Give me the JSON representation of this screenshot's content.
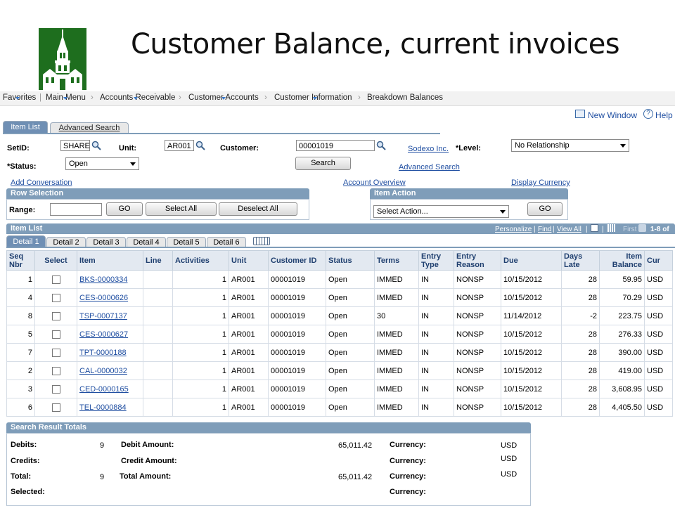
{
  "slide": {
    "title": "Customer Balance, current invoices"
  },
  "breadcrumb": [
    {
      "label": "Favorites",
      "has_arrow": true
    },
    {
      "label": "Main Menu",
      "has_arrow": true
    },
    {
      "label": "Accounts Receivable",
      "has_arrow": true
    },
    {
      "label": "Customer Accounts",
      "has_arrow": true
    },
    {
      "label": "Customer Information",
      "has_arrow": true
    },
    {
      "label": "Breakdown Balances",
      "has_arrow": false
    }
  ],
  "toplinks": {
    "new_window": "New Window",
    "help": "Help"
  },
  "tabs": {
    "item_list": "Item List",
    "advanced_search": "Advanced Search"
  },
  "form": {
    "setid_label": "SetID:",
    "setid_value": "SHARE",
    "unit_label": "Unit:",
    "unit_value": "AR001",
    "customer_label": "Customer:",
    "customer_value": "00001019",
    "customer_name": "Sodexo Inc.",
    "level_label": "*Level:",
    "level_value": "No Relationship",
    "status_label": "*Status:",
    "status_value": "Open",
    "search_button": "Search",
    "advanced_search_link": "Advanced Search",
    "add_conversation": "Add Conversation",
    "account_overview": "Account Overview",
    "display_currency": "Display Currency"
  },
  "row_selection": {
    "header": "Row Selection",
    "range_label": "Range:",
    "go": "GO",
    "select_all": "Select All",
    "deselect_all": "Deselect All"
  },
  "item_action": {
    "header": "Item Action",
    "placeholder": "Select Action...",
    "go": "GO"
  },
  "item_list": {
    "header": "Item List",
    "personalize": "Personalize",
    "find": "Find",
    "view_all": "View All",
    "first": "First",
    "range": "1-8 of",
    "detail_tabs": [
      "Detail 1",
      "Detail 2",
      "Detail 3",
      "Detail 4",
      "Detail 5",
      "Detail 6"
    ],
    "columns": [
      "Seq Nbr",
      "Select",
      "Item",
      "Line",
      "Activities",
      "Unit",
      "Customer ID",
      "Status",
      "Terms",
      "Entry Type",
      "Entry Reason",
      "Due",
      "Days Late",
      "Item Balance",
      "Cur"
    ],
    "rows": [
      {
        "seq": "1",
        "item": "BKS-0000334",
        "activities": "1",
        "unit": "AR001",
        "customer_id": "00001019",
        "status": "Open",
        "terms": "IMMED",
        "entry_type": "IN",
        "entry_reason": "NONSP",
        "due": "10/15/2012",
        "days_late": "28",
        "balance": "59.95",
        "cur": "USD"
      },
      {
        "seq": "4",
        "item": "CES-0000626",
        "activities": "1",
        "unit": "AR001",
        "customer_id": "00001019",
        "status": "Open",
        "terms": "IMMED",
        "entry_type": "IN",
        "entry_reason": "NONSP",
        "due": "10/15/2012",
        "days_late": "28",
        "balance": "70.29",
        "cur": "USD"
      },
      {
        "seq": "8",
        "item": "TSP-0007137",
        "activities": "1",
        "unit": "AR001",
        "customer_id": "00001019",
        "status": "Open",
        "terms": "30",
        "entry_type": "IN",
        "entry_reason": "NONSP",
        "due": "11/14/2012",
        "days_late": "-2",
        "balance": "223.75",
        "cur": "USD"
      },
      {
        "seq": "5",
        "item": "CES-0000627",
        "activities": "1",
        "unit": "AR001",
        "customer_id": "00001019",
        "status": "Open",
        "terms": "IMMED",
        "entry_type": "IN",
        "entry_reason": "NONSP",
        "due": "10/15/2012",
        "days_late": "28",
        "balance": "276.33",
        "cur": "USD"
      },
      {
        "seq": "7",
        "item": "TPT-0000188",
        "activities": "1",
        "unit": "AR001",
        "customer_id": "00001019",
        "status": "Open",
        "terms": "IMMED",
        "entry_type": "IN",
        "entry_reason": "NONSP",
        "due": "10/15/2012",
        "days_late": "28",
        "balance": "390.00",
        "cur": "USD"
      },
      {
        "seq": "2",
        "item": "CAL-0000032",
        "activities": "1",
        "unit": "AR001",
        "customer_id": "00001019",
        "status": "Open",
        "terms": "IMMED",
        "entry_type": "IN",
        "entry_reason": "NONSP",
        "due": "10/15/2012",
        "days_late": "28",
        "balance": "419.00",
        "cur": "USD"
      },
      {
        "seq": "3",
        "item": "CED-0000165",
        "activities": "1",
        "unit": "AR001",
        "customer_id": "00001019",
        "status": "Open",
        "terms": "IMMED",
        "entry_type": "IN",
        "entry_reason": "NONSP",
        "due": "10/15/2012",
        "days_late": "28",
        "balance": "3,608.95",
        "cur": "USD"
      },
      {
        "seq": "6",
        "item": "TEL-0000884",
        "activities": "1",
        "unit": "AR001",
        "customer_id": "00001019",
        "status": "Open",
        "terms": "IMMED",
        "entry_type": "IN",
        "entry_reason": "NONSP",
        "due": "10/15/2012",
        "days_late": "28",
        "balance": "4,405.50",
        "cur": "USD"
      }
    ]
  },
  "totals": {
    "header": "Search Result Totals",
    "debits_label": "Debits:",
    "debits_count": "9",
    "debit_amount_label": "Debit Amount:",
    "debit_amount": "65,011.42",
    "credits_label": "Credits:",
    "credit_amount_label": "Credit Amount:",
    "total_label": "Total:",
    "total_count": "9",
    "total_amount_label": "Total Amount:",
    "total_amount": "65,011.42",
    "selected_label": "Selected:",
    "currency_label": "Currency:",
    "currency_1": "USD",
    "currency_2": "USD",
    "currency_3": "USD"
  },
  "colors": {
    "header_blue": "#7f9db9",
    "link": "#1f4ea1",
    "logo_green": "#1e6e1e"
  }
}
